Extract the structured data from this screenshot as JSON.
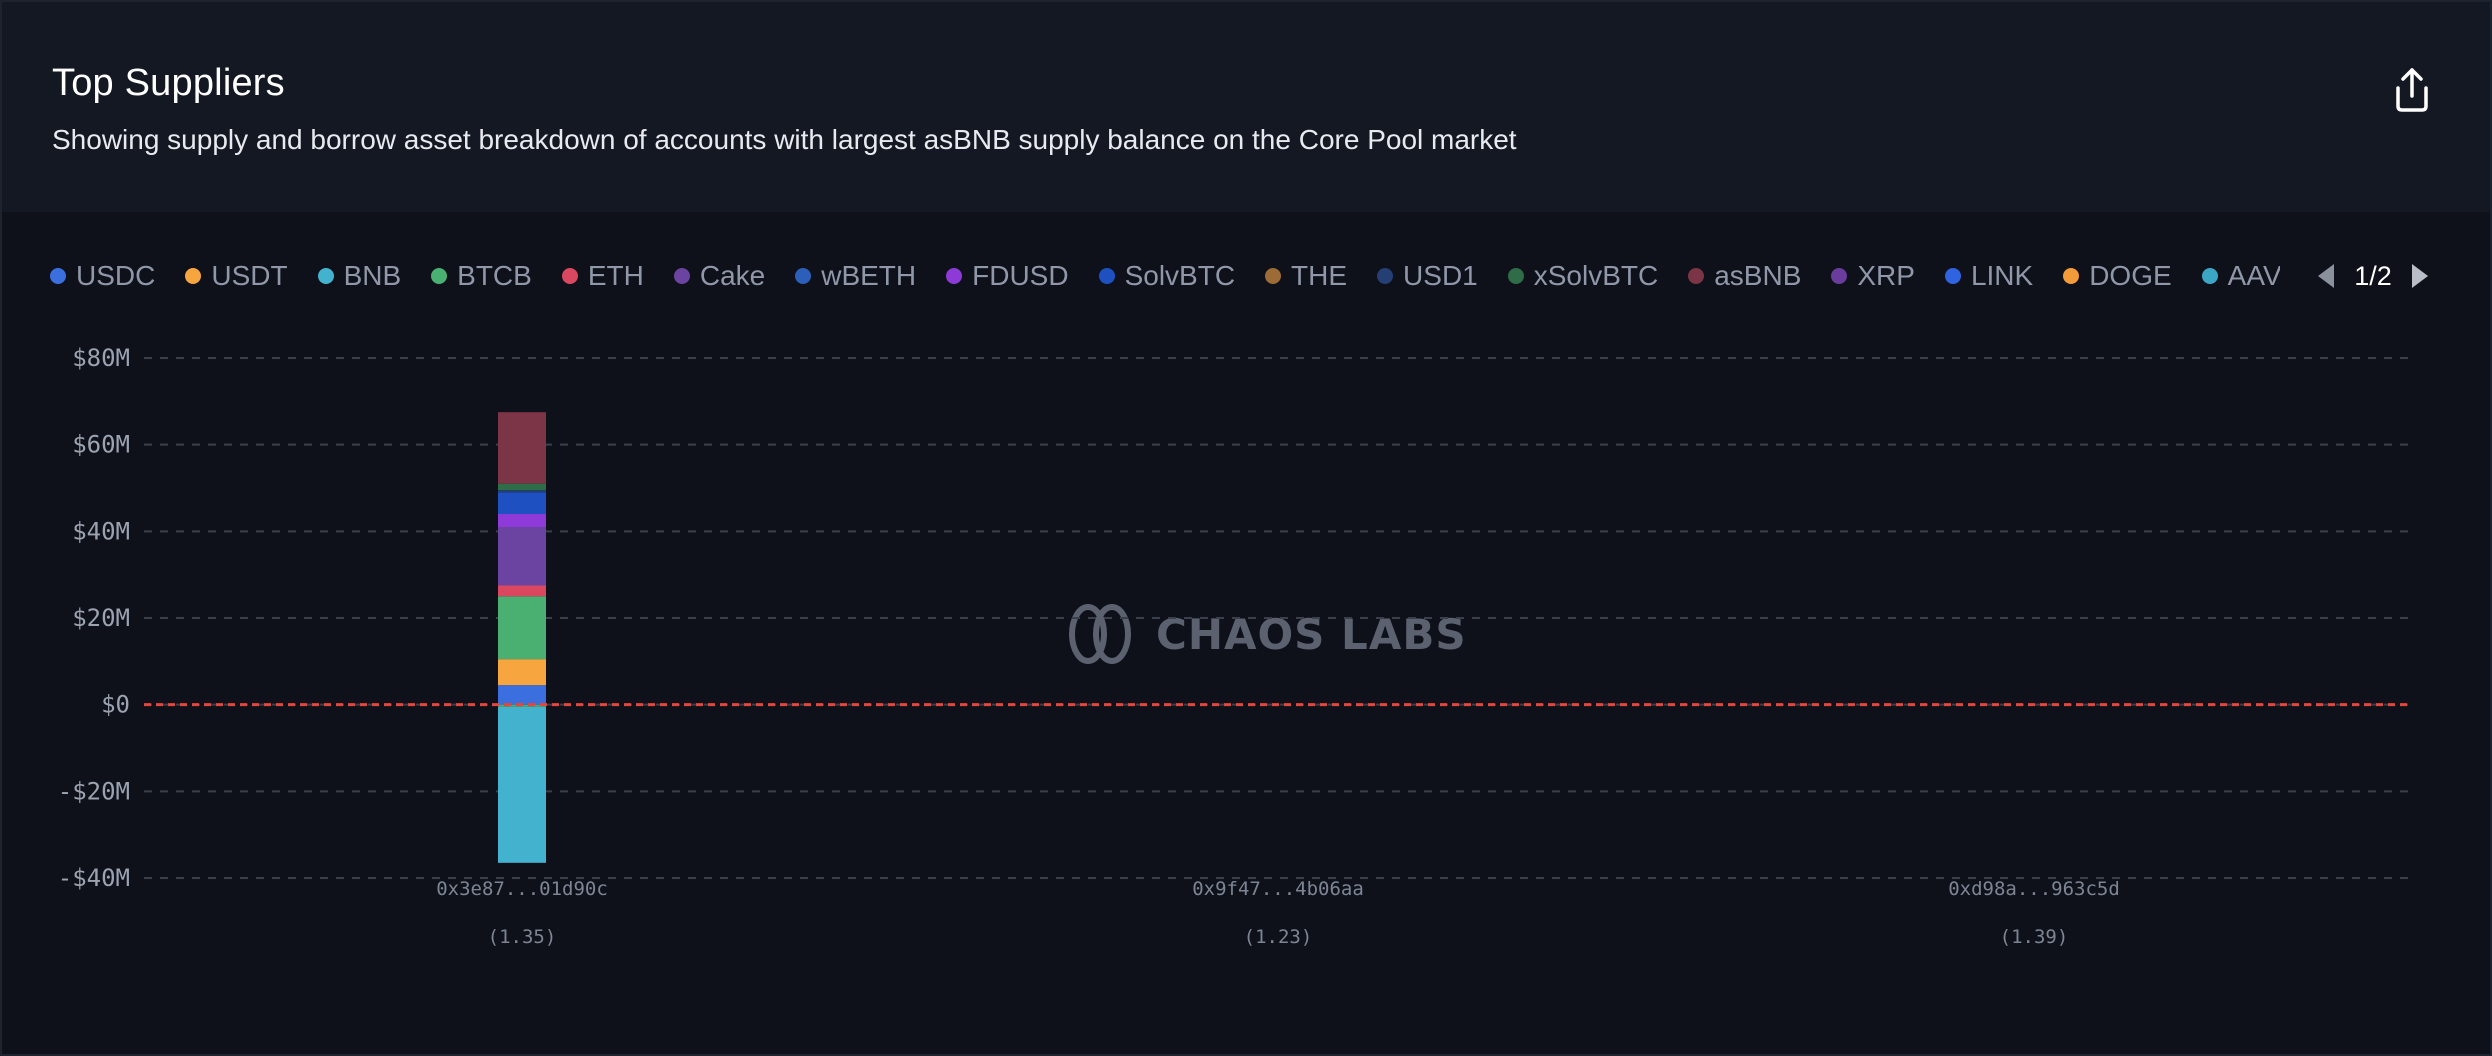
{
  "header": {
    "title": "Top Suppliers",
    "subtitle": "Showing supply and borrow asset breakdown of accounts with largest asBNB supply balance on the Core Pool market"
  },
  "legend": {
    "items": [
      {
        "label": "USDC",
        "color": "#3b6fe0"
      },
      {
        "label": "USDT",
        "color": "#f7a53e"
      },
      {
        "label": "BNB",
        "color": "#43b2cf"
      },
      {
        "label": "BTCB",
        "color": "#49b072"
      },
      {
        "label": "ETH",
        "color": "#d9485f"
      },
      {
        "label": "Cake",
        "color": "#6b43a0"
      },
      {
        "label": "wBETH",
        "color": "#2c5fba"
      },
      {
        "label": "FDUSD",
        "color": "#8e3ad8"
      },
      {
        "label": "SolvBTC",
        "color": "#1f50c2"
      },
      {
        "label": "THE",
        "color": "#9d6b36"
      },
      {
        "label": "USD1",
        "color": "#233f74"
      },
      {
        "label": "xSolvBTC",
        "color": "#2f6c48"
      },
      {
        "label": "asBNB",
        "color": "#7c3547"
      },
      {
        "label": "XRP",
        "color": "#6a3d9c"
      },
      {
        "label": "LINK",
        "color": "#2f63e0"
      },
      {
        "label": "DOGE",
        "color": "#f39a3a"
      },
      {
        "label": "AAVE",
        "color": "#3ca7c4"
      }
    ],
    "page": "1/2"
  },
  "watermark": "CHAOS LABS",
  "chart_data": {
    "type": "bar",
    "stacked": true,
    "title": "Top Suppliers",
    "categories": [
      "0x3e87...01d90c",
      "0x9f47...4b06aa",
      "0xd98a...963c5d"
    ],
    "category_sublabels": [
      "(1.35)",
      "(1.23)",
      "(1.39)"
    ],
    "y_ticks": [
      "$80M",
      "$60M",
      "$40M",
      "$20M",
      "$0",
      "-$20M",
      "-$40M"
    ],
    "ylim": [
      -40,
      80
    ],
    "y_unit": "$M",
    "grid": true,
    "legend_position": "top",
    "reference_line": {
      "y": 0,
      "color": "#e0473f",
      "style": "dashed"
    },
    "series": [
      {
        "name": "BTCB",
        "color": "#49b072",
        "values": [
          -0.5,
          0,
          0
        ]
      },
      {
        "name": "BNB",
        "color": "#43b2cf",
        "values": [
          -36,
          0,
          0
        ]
      },
      {
        "name": "USDC",
        "color": "#3b6fe0",
        "values": [
          4.5,
          0,
          0
        ]
      },
      {
        "name": "USDT",
        "color": "#f7a53e",
        "values": [
          6,
          0,
          0
        ]
      },
      {
        "name": "BTCB",
        "color": "#49b072",
        "values": [
          14.5,
          0,
          0
        ]
      },
      {
        "name": "ETH",
        "color": "#d9485f",
        "values": [
          2.5,
          0,
          0
        ]
      },
      {
        "name": "Cake",
        "color": "#6b43a0",
        "values": [
          13.5,
          0,
          0
        ]
      },
      {
        "name": "FDUSD",
        "color": "#8e3ad8",
        "values": [
          3,
          0,
          0
        ]
      },
      {
        "name": "SolvBTC",
        "color": "#1f50c2",
        "values": [
          5,
          0,
          0
        ]
      },
      {
        "name": "USD1",
        "color": "#233f74",
        "values": [
          0.5,
          0,
          0
        ]
      },
      {
        "name": "xSolvBTC",
        "color": "#2f6c48",
        "values": [
          1.5,
          0,
          0
        ]
      },
      {
        "name": "asBNB",
        "color": "#7c3547",
        "values": [
          16.5,
          0,
          0
        ]
      }
    ]
  }
}
